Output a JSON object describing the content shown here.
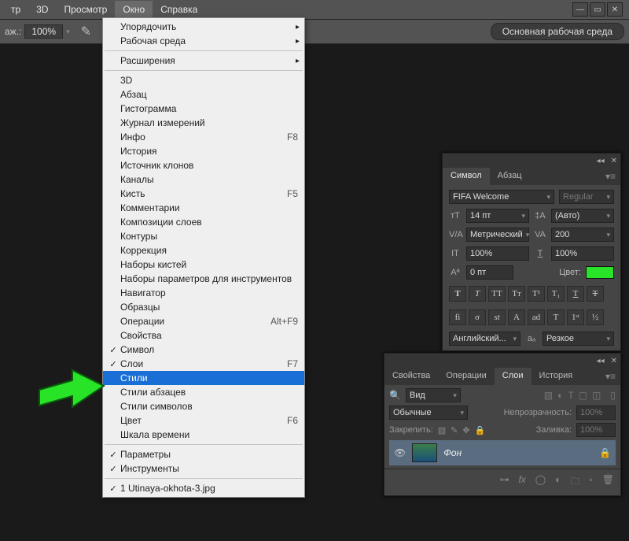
{
  "menubar": {
    "items": [
      "тр",
      "3D",
      "Просмотр",
      "Окно",
      "Справка"
    ],
    "active_index": 3
  },
  "topbar": {
    "zoom_label": "аж.:",
    "zoom_value": "100%",
    "workspace_button": "Основная рабочая среда"
  },
  "dropdown": {
    "groups": [
      [
        {
          "label": "Упорядочить",
          "sub": true
        },
        {
          "label": "Рабочая среда",
          "sub": true
        }
      ],
      [
        {
          "label": "Расширения",
          "sub": true
        }
      ],
      [
        {
          "label": "3D"
        },
        {
          "label": "Абзац"
        },
        {
          "label": "Гистограмма"
        },
        {
          "label": "Журнал измерений"
        },
        {
          "label": "Инфо",
          "shortcut": "F8"
        },
        {
          "label": "История"
        },
        {
          "label": "Источник клонов"
        },
        {
          "label": "Каналы"
        },
        {
          "label": "Кисть",
          "shortcut": "F5"
        },
        {
          "label": "Комментарии"
        },
        {
          "label": "Композиции слоев"
        },
        {
          "label": "Контуры"
        },
        {
          "label": "Коррекция"
        },
        {
          "label": "Наборы кистей"
        },
        {
          "label": "Наборы параметров для инструментов"
        },
        {
          "label": "Навигатор"
        },
        {
          "label": "Образцы"
        },
        {
          "label": "Операции",
          "shortcut": "Alt+F9"
        },
        {
          "label": "Свойства"
        },
        {
          "label": "Символ",
          "checked": true
        },
        {
          "label": "Слои",
          "checked": true,
          "shortcut": "F7"
        },
        {
          "label": "Стили",
          "highlight": true
        },
        {
          "label": "Стили абзацев"
        },
        {
          "label": "Стили символов"
        },
        {
          "label": "Цвет",
          "shortcut": "F6"
        },
        {
          "label": "Шкала времени"
        }
      ],
      [
        {
          "label": "Параметры",
          "checked": true
        },
        {
          "label": "Инструменты",
          "checked": true
        }
      ],
      [
        {
          "label": "1 Utinaya-okhota-3.jpg",
          "checked": true
        }
      ]
    ]
  },
  "char_panel": {
    "tabs": [
      "Символ",
      "Абзац"
    ],
    "font": "FIFA Welcome",
    "style": "Regular",
    "size": "14 пт",
    "leading": "(Авто)",
    "kerning": "Метрический",
    "tracking": "200",
    "vscale": "100%",
    "hscale": "100%",
    "baseline": "0 пт",
    "color_label": "Цвет:",
    "lang": "Английский...",
    "aa": "Резкое"
  },
  "layers_panel": {
    "tabs": [
      "Свойства",
      "Операции",
      "Слои",
      "История"
    ],
    "active_tab": 2,
    "filter_label": "Вид",
    "blend": "Обычные",
    "opacity_label": "Непрозрачность:",
    "opacity": "100%",
    "lock_label": "Закрепить:",
    "fill_label": "Заливка:",
    "fill": "100%",
    "layer_name": "Фон"
  }
}
